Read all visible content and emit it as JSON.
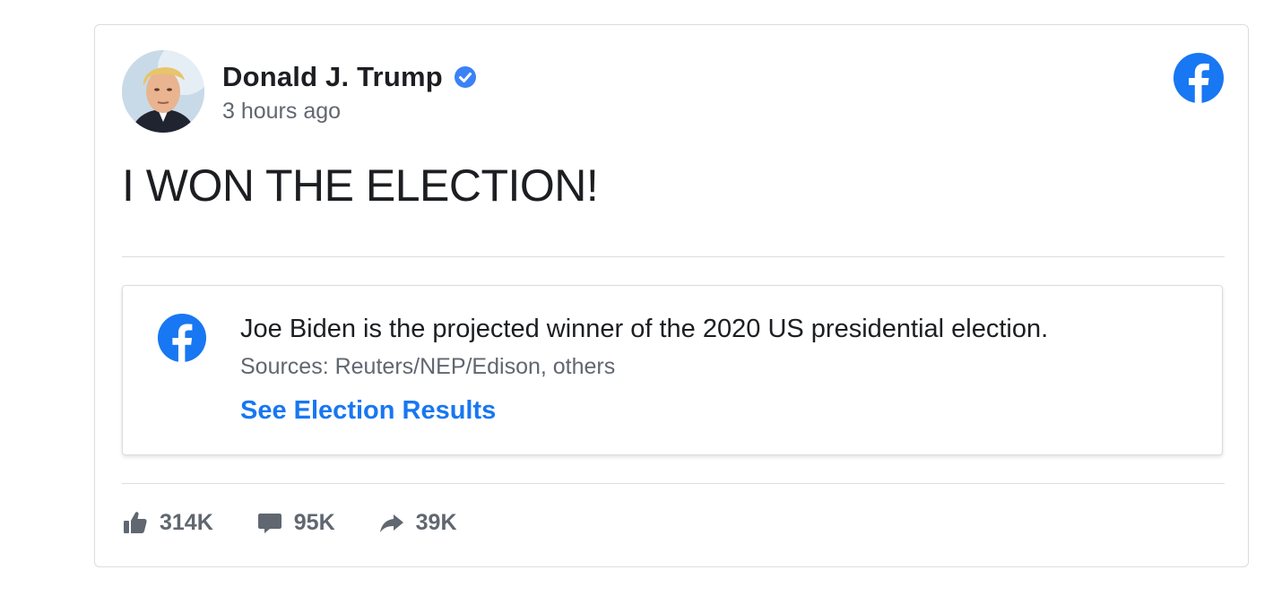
{
  "post": {
    "author": "Donald J. Trump",
    "timestamp": "3 hours ago",
    "text": "I WON THE ELECTION!"
  },
  "notice": {
    "text": "Joe Biden is the projected winner of the 2020 US presidential election.",
    "sources": "Sources: Reuters/NEP/Edison, others",
    "link_label": "See Election Results"
  },
  "stats": {
    "likes": "314K",
    "comments": "95K",
    "shares": "39K"
  },
  "icons": {
    "platform": "facebook-icon",
    "verified": "verified-badge-icon",
    "like": "thumbs-up-icon",
    "comment": "comment-icon",
    "share": "share-arrow-icon"
  },
  "colors": {
    "brand": "#1877f2",
    "verified": "#3b82f6",
    "text": "#1c1e21",
    "muted": "#606770"
  }
}
